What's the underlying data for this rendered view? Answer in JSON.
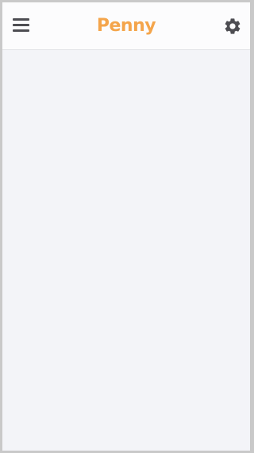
{
  "header": {
    "title": "Penny",
    "menu_icon": "hamburger-menu-icon",
    "settings_icon": "gear-icon"
  },
  "colors": {
    "accent": "#f4a54b",
    "icon": "#4d4d52",
    "header_bg": "#fcfcfd",
    "content_bg": "#f3f4f8",
    "frame": "#c9c9c9"
  }
}
